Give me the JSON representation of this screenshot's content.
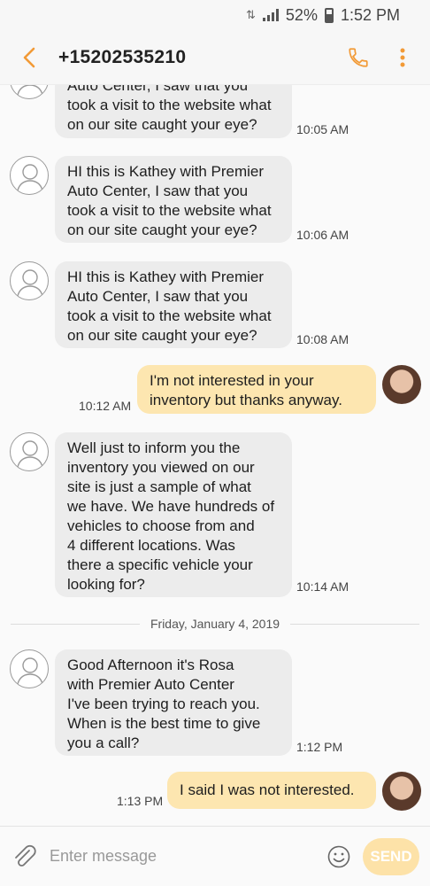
{
  "status_bar": {
    "battery": "52%",
    "time": "1:52 PM",
    "icons": [
      "data-saver-icon",
      "signal-icon",
      "battery-icon"
    ]
  },
  "header": {
    "title": "+15202535210",
    "back_icon": "back-arrow-icon",
    "call_icon": "phone-icon",
    "menu_icon": "more-vert-icon",
    "accent": "#f29a36"
  },
  "messages": [
    {
      "direction": "in",
      "text": "Auto Center, I saw that you\ntook a visit to the website what\non our site caught your eye?",
      "time": "10:05 AM"
    },
    {
      "direction": "in",
      "text": "HI this is Kathey with Premier\nAuto Center, I saw that you\ntook a visit to the website what\non our site caught your eye?",
      "time": "10:06 AM"
    },
    {
      "direction": "in",
      "text": "HI this is Kathey with Premier\nAuto Center, I saw that you\ntook a visit to the website what\non our site caught your eye?",
      "time": "10:08 AM"
    },
    {
      "direction": "out",
      "text": "I'm not interested in your\ninventory but thanks anyway.",
      "time": "10:12 AM"
    },
    {
      "direction": "in",
      "text": "Well just to inform you the\ninventory you viewed on our\nsite is just a sample of what\nwe have. We have hundreds of\nvehicles to choose from and\n4 different locations. Was\nthere a specific vehicle your\nlooking for?",
      "time": "10:14 AM"
    },
    {
      "direction": "in",
      "text": "Good Afternoon it's Rosa\nwith Premier Auto Center\nI've been trying to reach you.\nWhen is the best time to give\nyou a call?",
      "time": "1:12 PM"
    },
    {
      "direction": "out",
      "text": "I said I was not interested.",
      "time": "1:13 PM"
    }
  ],
  "date_separator": "Friday, January 4, 2019",
  "compose": {
    "placeholder": "Enter message",
    "send_label": "SEND",
    "attach_icon": "paperclip-icon",
    "emoji_icon": "emoji-icon"
  },
  "colors": {
    "incoming_bubble": "#ececec",
    "outgoing_bubble": "#fde6b0",
    "send_button": "#fde2a8"
  }
}
